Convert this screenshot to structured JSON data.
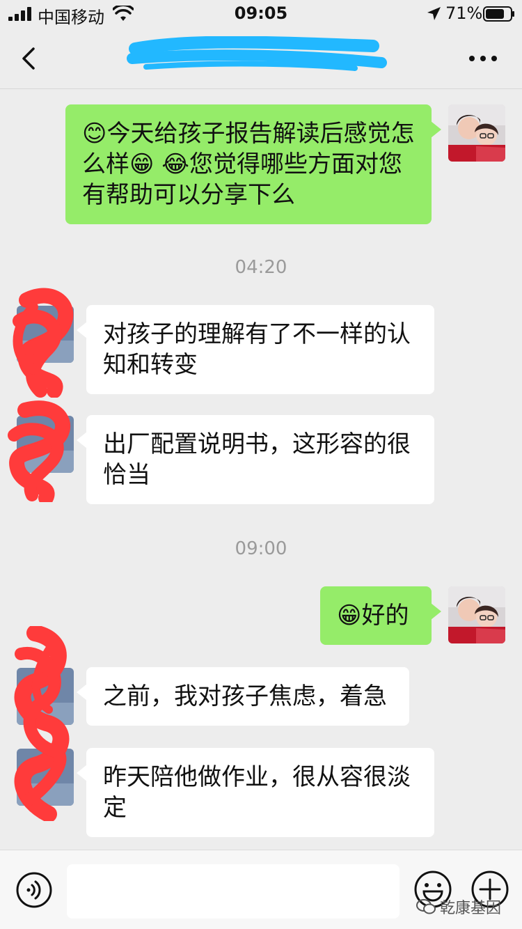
{
  "status_bar": {
    "carrier": "中国移动",
    "time": "09:05",
    "battery_percent": "71%"
  },
  "nav": {
    "back_icon": "chevron-left-icon",
    "more_icon": "ellipsis-icon"
  },
  "messages": [
    {
      "side": "sent",
      "text": "😊今天给孩子报告解读后感觉怎么样😁 😂您觉得哪些方面对您有帮助可以分享下么"
    },
    {
      "type": "timestamp",
      "text": "04:20"
    },
    {
      "side": "received",
      "text": "对孩子的理解有了不一样的认知和转变"
    },
    {
      "side": "received",
      "text": "出厂配置说明书，这形容的很恰当"
    },
    {
      "type": "timestamp",
      "text": "09:00"
    },
    {
      "side": "sent",
      "text": "😁好的"
    },
    {
      "side": "received",
      "text": "之前，我对孩子焦虑，着急"
    },
    {
      "side": "received",
      "text": "昨天陪他做作业，很从容很淡定"
    }
  ],
  "input_bar": {
    "placeholder": "",
    "voice_icon": "voice-icon",
    "emoji_icon": "emoji-icon",
    "plus_icon": "plus-icon"
  },
  "watermark": "乾康基因",
  "colors": {
    "background": "#ededed",
    "sent_bubble": "#95ec69",
    "received_bubble": "#ffffff",
    "timestamp": "#9a9a9a",
    "redaction_blue": "#22b8ff",
    "redaction_red": "#ff3b3b"
  }
}
